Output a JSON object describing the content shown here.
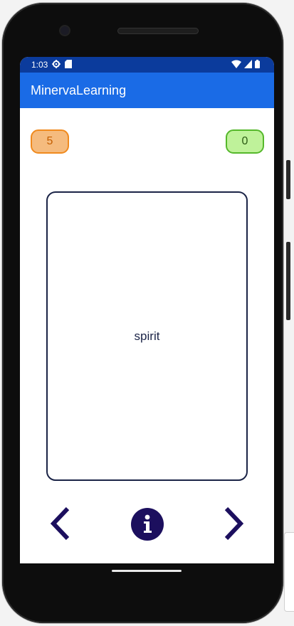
{
  "status_bar": {
    "time": "1:03",
    "left_icons": [
      "settings-icon",
      "sd-card-icon"
    ],
    "right_icons": [
      "wifi-icon",
      "signal-icon",
      "battery-icon"
    ],
    "color": "#0b3b9c"
  },
  "app_bar": {
    "title": "MinervaLearning",
    "color": "#1a6be6"
  },
  "counters": {
    "left_value": "5",
    "left_color": "#f5bb7e",
    "right_value": "0",
    "right_color": "#bff29a"
  },
  "card": {
    "word": "spirit"
  },
  "navigation": {
    "prev_icon": "chevron-left-icon",
    "info_icon": "info-icon",
    "next_icon": "chevron-right-icon",
    "accent_color": "#1c0f5e"
  }
}
